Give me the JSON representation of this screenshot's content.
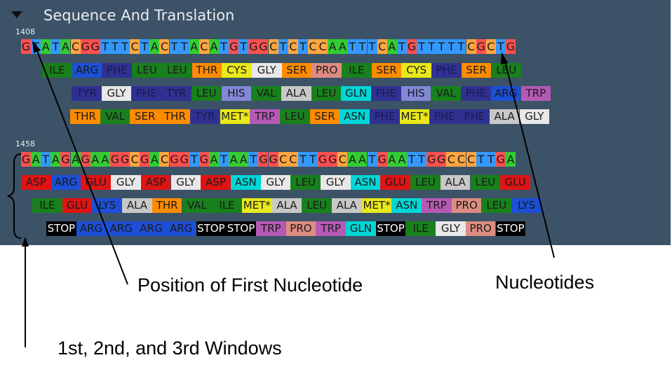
{
  "panel": {
    "title": "Sequence And Translation"
  },
  "colors": {
    "A": "#33cc33",
    "C": "#ffa640",
    "G": "#ff5050",
    "T": "#3399ff",
    "ILE": "#18801c",
    "ARG": "#1c4fd6",
    "PHE": "#2f3191",
    "LEU": "#18801c",
    "THR": "#ff8c00",
    "CYS": "#e8e81a",
    "GLY": "#e8e8e8",
    "SER": "#ff8c00",
    "PRO": "#dd8c82",
    "TYR": "#2f3191",
    "HIS": "#8287d8",
    "VAL": "#18801c",
    "ALA": "#c8c8c8",
    "GLN": "#00d6d6",
    "MET*": "#e8e81a",
    "TRP": "#b45ab4",
    "ASN": "#00d6d6",
    "ASP": "#e01414",
    "GLU": "#e01414",
    "LYS": "#1c4fd6",
    "STOP": "#000000"
  },
  "blocks": [
    {
      "position": "1408",
      "nucleotides": "GTATACGGTTTCTACTTACATGTGGCTCTCCAATTTCATGTTTTTCGCTG",
      "frames": [
        [
          "ILE",
          "ARG",
          "PHE",
          "LEU",
          "LEU",
          "THR",
          "CYS",
          "GLY",
          "SER",
          "PRO",
          "ILE",
          "SER",
          "CYS",
          "PHE",
          "SER",
          "LEU"
        ],
        [
          "TYR",
          "GLY",
          "PHE",
          "TYR",
          "LEU",
          "HIS",
          "VAL",
          "ALA",
          "LEU",
          "GLN",
          "PHE",
          "HIS",
          "VAL",
          "PHE",
          "ARG",
          "TRP"
        ],
        [
          "THR",
          "VAL",
          "SER",
          "THR",
          "TYR",
          "MET*",
          "TRP",
          "LEU",
          "SER",
          "ASN",
          "PHE",
          "MET*",
          "PHE",
          "PHE",
          "ALA",
          "GLY"
        ]
      ]
    },
    {
      "position": "1458",
      "nucleotides": "GATAGAGAAGGCGACGGTGATAATGGCCTTGGCAATGAATTGGCCCTTGA",
      "frames": [
        [
          "ASP",
          "ARG",
          "GLU",
          "GLY",
          "ASP",
          "GLY",
          "ASP",
          "ASN",
          "GLY",
          "LEU",
          "GLY",
          "ASN",
          "GLU",
          "LEU",
          "ALA",
          "LEU",
          "GLU"
        ],
        [
          "ILE",
          "GLU",
          "LYS",
          "ALA",
          "THR",
          "VAL",
          "ILE",
          "MET*",
          "ALA",
          "LEU",
          "ALA",
          "MET*",
          "ASN",
          "TRP",
          "PRO",
          "LEU",
          "LYS"
        ],
        [
          "STOP",
          "ARG",
          "ARG",
          "ARG",
          "ARG",
          "STOP",
          "STOP",
          "TRP",
          "PRO",
          "TRP",
          "GLN",
          "STOP",
          "ILE",
          "GLY",
          "PRO",
          "STOP"
        ]
      ]
    }
  ],
  "callouts": {
    "position_label": "Position of First Nucleotide",
    "nucleotides_label": "Nucleotides",
    "windows_label": "1st, 2nd, and 3rd Windows"
  }
}
